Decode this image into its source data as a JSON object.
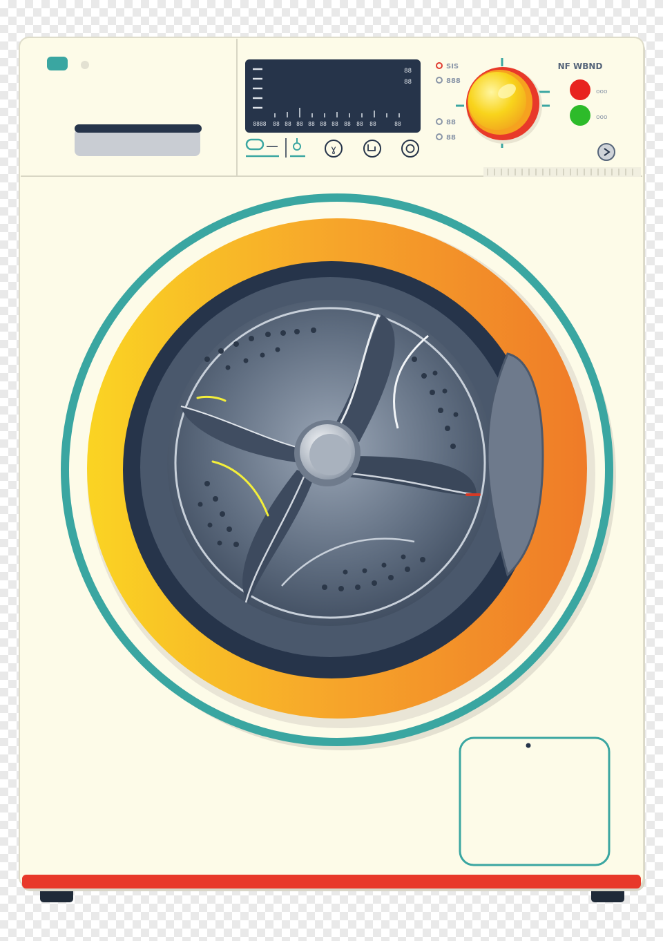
{
  "panel": {
    "display": {
      "readout_top": "88",
      "readout_mid": "88",
      "scale_labels": [
        "8888",
        "88",
        "88",
        "88",
        "88",
        "88",
        "88",
        "88",
        "88",
        "88",
        "88"
      ]
    },
    "options_left": [
      {
        "label": "SIS",
        "color": "#e03a2f"
      },
      {
        "label": "888",
        "color": "#8a96a8"
      },
      {
        "label": "88",
        "color": "#8a96a8"
      },
      {
        "label": "88",
        "color": "#8a96a8"
      }
    ],
    "brand_label": "NF WBND",
    "indicators": [
      {
        "label": "ooo",
        "color": "#e8231f"
      },
      {
        "label": "ooo",
        "color": "#2dbb2a"
      }
    ],
    "program_buttons": [
      "temp-icon",
      "rinse-icon",
      "spin-icon",
      "eco-icon",
      "power-icon"
    ]
  },
  "colors": {
    "body": "#fdfbe8",
    "teal": "#3aa6a1",
    "ring_yellow": "#f9cc22",
    "ring_orange": "#f07f2a",
    "glass": "#3c4a5e",
    "base_red": "#e8392a",
    "navy": "#26344a"
  }
}
